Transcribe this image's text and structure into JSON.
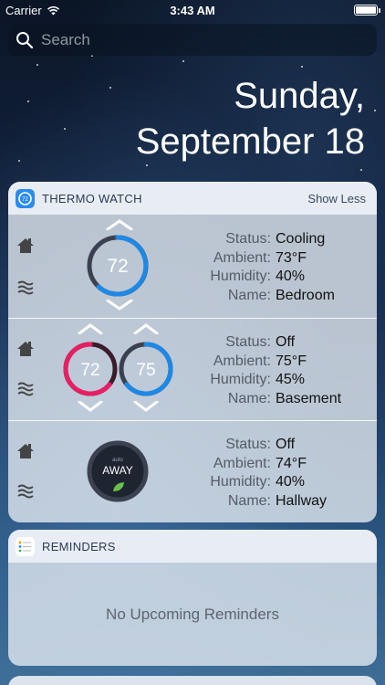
{
  "status_bar": {
    "carrier": "Carrier",
    "time": "3:43 AM"
  },
  "search": {
    "placeholder": "Search"
  },
  "date": {
    "weekday": "Sunday,",
    "month_day": "September 18"
  },
  "thermo_widget": {
    "title": "THERMO WATCH",
    "action": "Show Less",
    "labels": {
      "status": "Status:",
      "ambient": "Ambient:",
      "humidity": "Humidity:",
      "name": "Name:"
    },
    "thermostats": [
      {
        "setpoints": [
          "72"
        ],
        "status": "Cooling",
        "ambient": "73°F",
        "humidity": "40%",
        "name": "Bedroom",
        "colors": [
          "#1e88e5"
        ]
      },
      {
        "setpoints": [
          "72",
          "75"
        ],
        "status": "Off",
        "ambient": "75°F",
        "humidity": "45%",
        "name": "Basement",
        "colors": [
          "#e91e63",
          "#1e88e5"
        ]
      },
      {
        "setpoints_small": "auto",
        "setpoint_mode": "AWAY",
        "status": "Off",
        "ambient": "74°F",
        "humidity": "40%",
        "name": "Hallway"
      }
    ]
  },
  "reminders_widget": {
    "title": "REMINDERS",
    "empty_text": "No Upcoming Reminders"
  }
}
